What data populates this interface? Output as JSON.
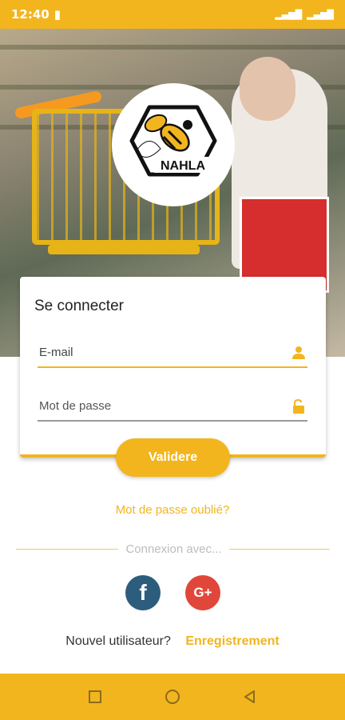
{
  "status_bar": {
    "time": "12:40"
  },
  "login": {
    "title": "Se connecter",
    "email_placeholder": "E-mail",
    "password_placeholder": "Mot de passe",
    "submit_label": "Validere"
  },
  "forgot_password": "Mot de passe oublié?",
  "social": {
    "divider_text": "Connexion avec...",
    "facebook_glyph": "f",
    "google_glyph": "G+"
  },
  "register": {
    "new_user_label": "Nouvel utilisateur?",
    "register_label": "Enregistrement"
  },
  "logo": {
    "text": "NAHLA"
  },
  "colors": {
    "accent": "#f2b51d",
    "facebook": "#2c5d7d",
    "google": "#e0473a"
  }
}
